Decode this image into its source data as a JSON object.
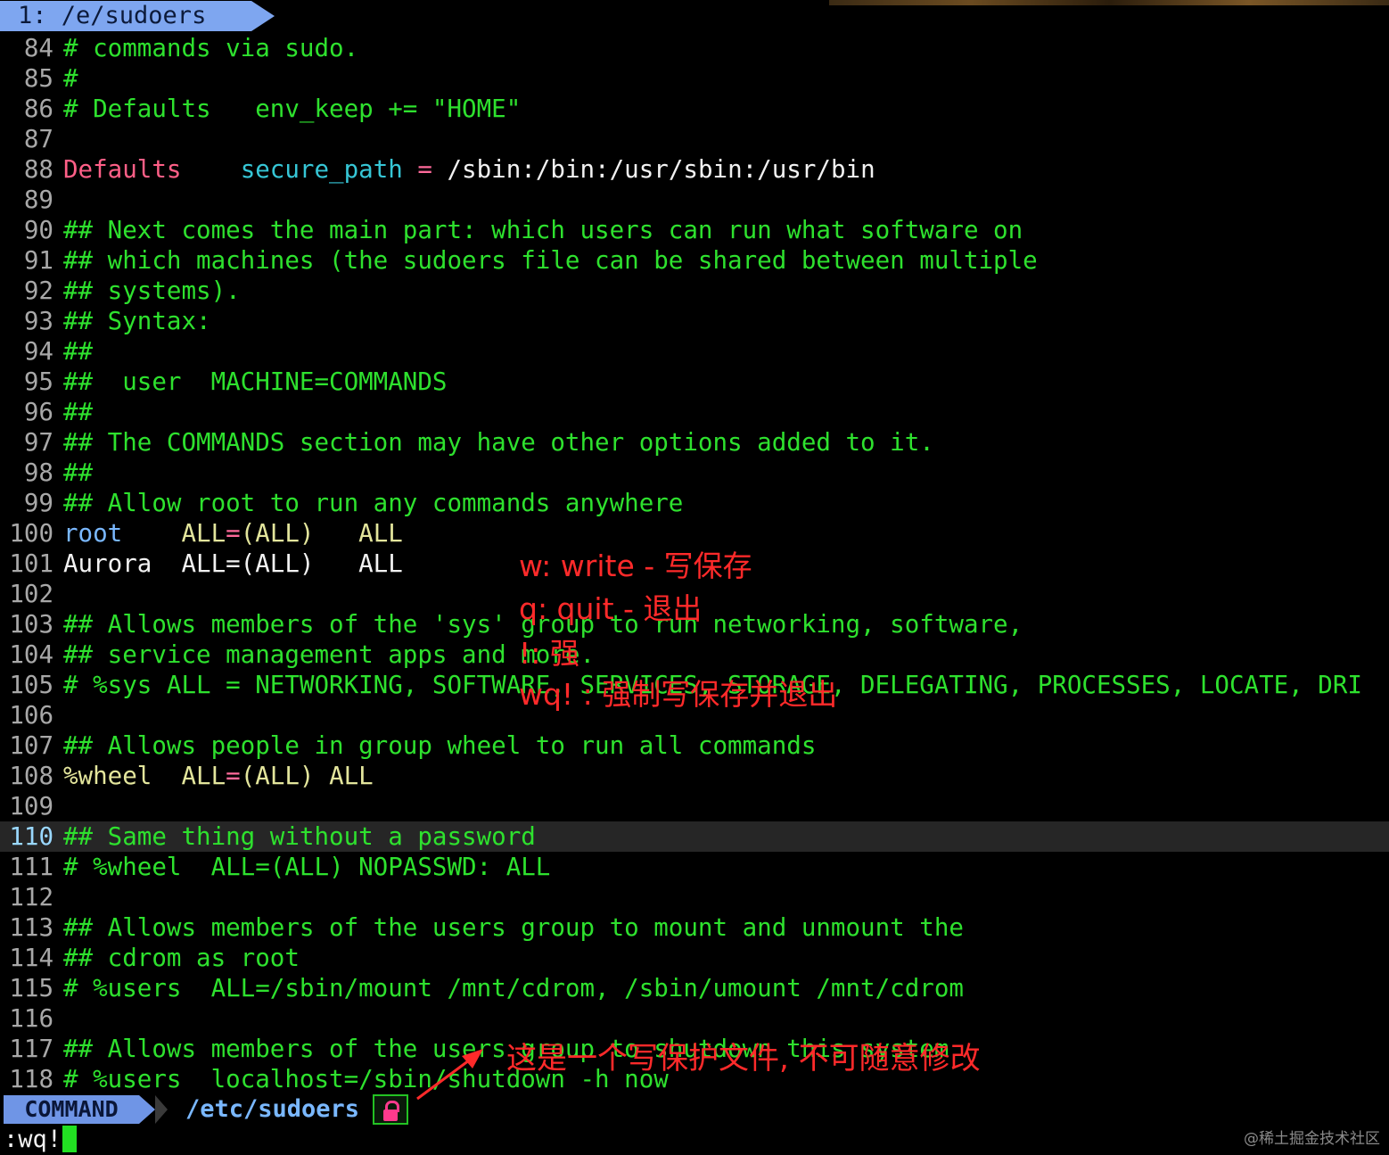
{
  "tabline": {
    "tab_label": "1: /e/sudoers"
  },
  "lines": [
    {
      "num": "84",
      "segs": [
        {
          "t": "# commands via sudo.",
          "c": "green"
        }
      ]
    },
    {
      "num": "85",
      "segs": [
        {
          "t": "#",
          "c": "green"
        }
      ]
    },
    {
      "num": "86",
      "segs": [
        {
          "t": "# Defaults   env_keep += \"HOME\"",
          "c": "green"
        }
      ]
    },
    {
      "num": "87",
      "segs": []
    },
    {
      "num": "88",
      "segs": [
        {
          "t": "Defaults",
          "c": "pink"
        },
        {
          "t": "    ",
          "c": "white"
        },
        {
          "t": "secure_path",
          "c": "cyan"
        },
        {
          "t": " ",
          "c": "white"
        },
        {
          "t": "=",
          "c": "op"
        },
        {
          "t": " /sbin:/bin:/usr/sbin:/usr/bin",
          "c": "white"
        }
      ]
    },
    {
      "num": "89",
      "segs": []
    },
    {
      "num": "90",
      "segs": [
        {
          "t": "## Next comes the main part: which users can run what software on",
          "c": "green"
        }
      ]
    },
    {
      "num": "91",
      "segs": [
        {
          "t": "## which machines (the sudoers file can be shared between multiple",
          "c": "green"
        }
      ]
    },
    {
      "num": "92",
      "segs": [
        {
          "t": "## systems).",
          "c": "green"
        }
      ]
    },
    {
      "num": "93",
      "segs": [
        {
          "t": "## Syntax:",
          "c": "green"
        }
      ]
    },
    {
      "num": "94",
      "segs": [
        {
          "t": "##",
          "c": "green"
        }
      ]
    },
    {
      "num": "95",
      "segs": [
        {
          "t": "##  user  MACHINE=COMMANDS",
          "c": "green"
        }
      ]
    },
    {
      "num": "96",
      "segs": [
        {
          "t": "##",
          "c": "green"
        }
      ]
    },
    {
      "num": "97",
      "segs": [
        {
          "t": "## The COMMANDS section may have other options added to it.",
          "c": "green"
        }
      ]
    },
    {
      "num": "98",
      "segs": [
        {
          "t": "##",
          "c": "green"
        }
      ]
    },
    {
      "num": "99",
      "segs": [
        {
          "t": "## Allow root to run any commands anywhere",
          "c": "green"
        }
      ]
    },
    {
      "num": "100",
      "segs": [
        {
          "t": "root",
          "c": "blue"
        },
        {
          "t": "    ",
          "c": "white"
        },
        {
          "t": "ALL",
          "c": "yel"
        },
        {
          "t": "=",
          "c": "op"
        },
        {
          "t": "(ALL)",
          "c": "yel"
        },
        {
          "t": "   ",
          "c": "white"
        },
        {
          "t": "ALL",
          "c": "yel"
        }
      ]
    },
    {
      "num": "101",
      "segs": [
        {
          "t": "Aurora  ALL=(ALL)   ALL",
          "c": "white"
        }
      ]
    },
    {
      "num": "102",
      "segs": []
    },
    {
      "num": "103",
      "segs": [
        {
          "t": "## Allows members of the 'sys' group to run networking, software,",
          "c": "green"
        }
      ]
    },
    {
      "num": "104",
      "segs": [
        {
          "t": "## service management apps and more.",
          "c": "green"
        }
      ]
    },
    {
      "num": "105",
      "segs": [
        {
          "t": "# %sys ALL = NETWORKING, SOFTWARE, SERVICES, STORAGE, DELEGATING, PROCESSES, LOCATE, DRI",
          "c": "green"
        }
      ]
    },
    {
      "num": "106",
      "segs": []
    },
    {
      "num": "107",
      "segs": [
        {
          "t": "## Allows people in group wheel to run all commands",
          "c": "green"
        }
      ]
    },
    {
      "num": "108",
      "segs": [
        {
          "t": "%wheel",
          "c": "yel"
        },
        {
          "t": "  ",
          "c": "white"
        },
        {
          "t": "ALL",
          "c": "yel"
        },
        {
          "t": "=",
          "c": "op"
        },
        {
          "t": "(ALL)",
          "c": "yel"
        },
        {
          "t": " ",
          "c": "white"
        },
        {
          "t": "ALL",
          "c": "yel"
        }
      ]
    },
    {
      "num": "109",
      "segs": []
    },
    {
      "num": "110",
      "cur": true,
      "segs": [
        {
          "t": "## Same thing without a password",
          "c": "green"
        }
      ]
    },
    {
      "num": "111",
      "segs": [
        {
          "t": "# %wheel  ALL=(ALL) NOPASSWD: ALL",
          "c": "green"
        }
      ]
    },
    {
      "num": "112",
      "segs": []
    },
    {
      "num": "113",
      "segs": [
        {
          "t": "## Allows members of the users group to mount and unmount the",
          "c": "green"
        }
      ]
    },
    {
      "num": "114",
      "segs": [
        {
          "t": "## cdrom as root",
          "c": "green"
        }
      ]
    },
    {
      "num": "115",
      "segs": [
        {
          "t": "# %users  ALL=/sbin/mount /mnt/cdrom, /sbin/umount /mnt/cdrom",
          "c": "green"
        }
      ]
    },
    {
      "num": "116",
      "segs": []
    },
    {
      "num": "117",
      "segs": [
        {
          "t": "## Allows members of the users group to shutdown this system",
          "c": "green"
        }
      ]
    },
    {
      "num": "118",
      "segs": [
        {
          "t": "# %users  localhost=/sbin/shutdown -h now",
          "c": "green"
        }
      ]
    }
  ],
  "statusline": {
    "mode": "COMMAND",
    "filename": "/etc/sudoers",
    "readonly_icon": "lock-icon"
  },
  "cmdline": {
    "text": ":wq!"
  },
  "annotations": {
    "w": "w: write - 写保存",
    "q": "q: quit - 退出",
    "bang": "!: 强",
    "wq": "wq! : 强制写保存并退出",
    "readonly_note": "这是一个写保护文件, 不可随意修改"
  },
  "watermark": "@稀土掘金技术社区",
  "colors": {
    "comment": "#2ee12e",
    "keyword": "#ff5f87",
    "identifier": "#36c6d6",
    "user": "#7ab8ff",
    "value": "#e3e59c",
    "annotation": "#ff2a2a"
  }
}
